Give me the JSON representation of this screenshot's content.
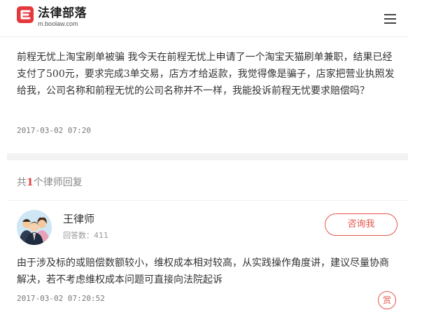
{
  "header": {
    "logo_cn": "法律部落",
    "logo_url": "m.boolaw.com",
    "brand_color": "#e4393c"
  },
  "question": {
    "text": "前程无忧上淘宝刷单被骗 我今天在前程无忧上申请了一个淘宝天猫刷单兼职，结果已经支付了500元，要求完成3单交易，店方才给返款，我觉得像是骗子，店家把营业执照发给我，公司名称和前程无忧的公司名称并不一样，我能投诉前程无忧要求赔偿吗？",
    "time": "2017-03-02 07:20"
  },
  "replies": {
    "prefix": "共",
    "count": "1",
    "suffix": "个律师回复"
  },
  "answer": {
    "lawyer_name": "王律师",
    "answer_count_label": "回答数：411",
    "consult_label": "咨询我",
    "text": "由于涉及标的或赔偿数额较小，维权成本相对较高，从实践操作角度讲，建议尽量协商解决，若不考虑维权成本问题可直接向法院起诉",
    "time": "2017-03-02 07:20:52",
    "reward_label": "赏",
    "accent_color": "#e4574b"
  }
}
